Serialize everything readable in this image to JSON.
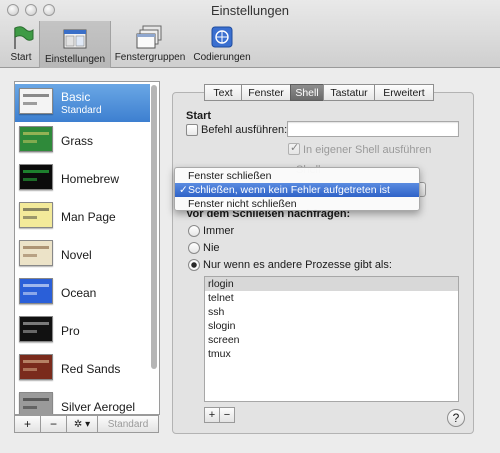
{
  "window": {
    "title": "Einstellungen"
  },
  "toolbar": {
    "items": [
      {
        "label": "Start",
        "icon": "flag-icon"
      },
      {
        "label": "Einstellungen",
        "icon": "window-settings-icon"
      },
      {
        "label": "Fenstergruppen",
        "icon": "window-group-icon"
      },
      {
        "label": "Codierungen",
        "icon": "encoding-icon"
      }
    ]
  },
  "profiles": [
    {
      "name": "Basic",
      "sub": "Standard",
      "bg": "#f4f4f4",
      "fg": "#333333"
    },
    {
      "name": "Grass",
      "sub": "",
      "bg": "#2f8a3a",
      "fg": "#e6d36a"
    },
    {
      "name": "Homebrew",
      "sub": "",
      "bg": "#0b0b0b",
      "fg": "#2ee04a"
    },
    {
      "name": "Man Page",
      "sub": "",
      "bg": "#f3ea9a",
      "fg": "#333333"
    },
    {
      "name": "Novel",
      "sub": "",
      "bg": "#ece3c8",
      "fg": "#7a5330"
    },
    {
      "name": "Ocean",
      "sub": "",
      "bg": "#2a5fd8",
      "fg": "#ffffff"
    },
    {
      "name": "Pro",
      "sub": "",
      "bg": "#111111",
      "fg": "#d0d0d0"
    },
    {
      "name": "Red Sands",
      "sub": "",
      "bg": "#7a2b1c",
      "fg": "#e8c9a0"
    },
    {
      "name": "Silver Aerogel",
      "sub": "",
      "bg": "#9a9a9a",
      "fg": "#222222"
    }
  ],
  "sidebar_buttons": {
    "add": "+",
    "remove": "−",
    "gear": "✲ ▾",
    "default": "Standard"
  },
  "tabs": [
    "Text",
    "Fenster",
    "Shell",
    "Tastatur",
    "Erweitert"
  ],
  "selected_tab": "Shell",
  "shell": {
    "start_heading": "Start",
    "run_command_label": "Befehl ausführen:",
    "run_command_value": "",
    "in_shell_label": "In eigener Shell ausführen",
    "partially_hidden_text": "Shell",
    "ask_heading": "Vor dem Schließen nachfragen:",
    "radio_options": [
      "Immer",
      "Nie",
      "Nur wenn es andere Prozesse gibt als:"
    ],
    "selected_radio": 2,
    "processes": [
      "rlogin",
      "telnet",
      "ssh",
      "slogin",
      "screen",
      "tmux"
    ],
    "add_label": "+",
    "remove_label": "−",
    "help_label": "?"
  },
  "popup_menu": {
    "items": [
      "Fenster schließen",
      "Schließen, wenn kein Fehler aufgetreten ist",
      "Fenster nicht schließen"
    ],
    "selected_index": 1,
    "check": "✓"
  },
  "colors": {
    "selection": "#3d7fd0",
    "menu_highlight": "#2f63c8"
  }
}
